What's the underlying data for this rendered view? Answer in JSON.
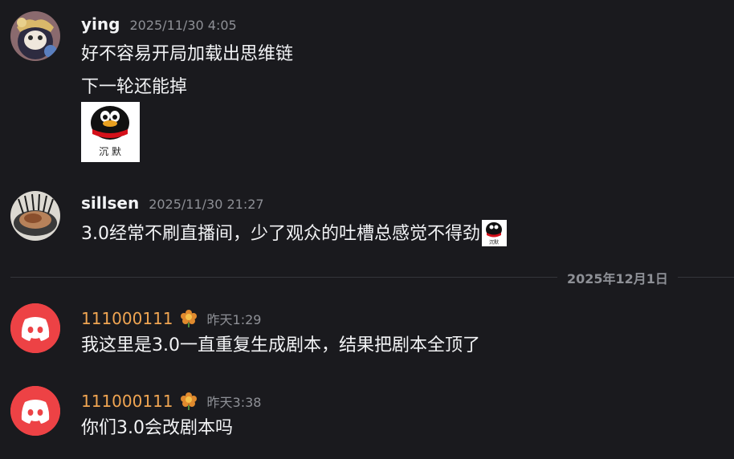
{
  "messages": [
    {
      "author": "ying",
      "timestamp": "2025/11/30 4:05",
      "lines": [
        "好不容易开局加载出思维链",
        "下一轮还能掉"
      ],
      "sticker_text": "沉 默"
    },
    {
      "author": "sillsen",
      "timestamp": "2025/11/30 21:27",
      "text": "3.0经常不刷直播间，少了观众的吐槽总感觉不得劲",
      "emoji_text": "沉默"
    }
  ],
  "date_divider": "2025年12月1日",
  "messages_after": [
    {
      "author": "111000111",
      "badge": "flower-badge-icon",
      "timestamp": "昨天1:29",
      "text": "我这里是3.0一直重复生成剧本，结果把剧本全顶了"
    },
    {
      "author": "111000111",
      "badge": "flower-badge-icon",
      "timestamp": "昨天3:38",
      "text": "你们3.0会改剧本吗"
    }
  ],
  "colors": {
    "background": "#1a1a1e",
    "discord_red": "#ed4245",
    "orange_name": "#f0a552"
  }
}
